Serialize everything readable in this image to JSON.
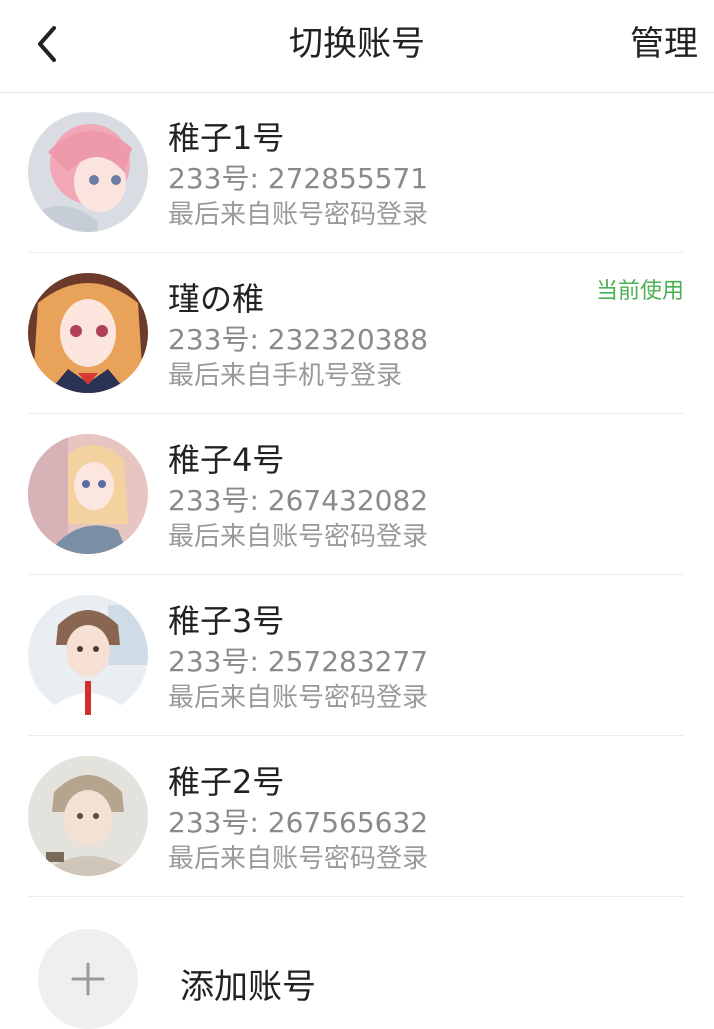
{
  "header": {
    "title": "切换账号",
    "manage_label": "管理",
    "back_icon": "chevron-left-icon"
  },
  "accounts": [
    {
      "name": "稚子1号",
      "id": "233号: 272855571",
      "login": "最后来自账号密码登录",
      "badge": ""
    },
    {
      "name": "瑾の稚",
      "id": "233号: 232320388",
      "login": "最后来自手机号登录",
      "badge": "当前使用"
    },
    {
      "name": "稚子4号",
      "id": "233号: 267432082",
      "login": "最后来自账号密码登录",
      "badge": ""
    },
    {
      "name": "稚子3号",
      "id": "233号: 257283277",
      "login": "最后来自账号密码登录",
      "badge": ""
    },
    {
      "name": "稚子2号",
      "id": "233号: 267565632",
      "login": "最后来自账号密码登录",
      "badge": ""
    }
  ],
  "add_account": {
    "label": "添加账号",
    "icon": "plus-icon"
  },
  "colors": {
    "current_badge": "#4caf50",
    "secondary_text": "#8a8a8a",
    "divider": "#ececec"
  }
}
